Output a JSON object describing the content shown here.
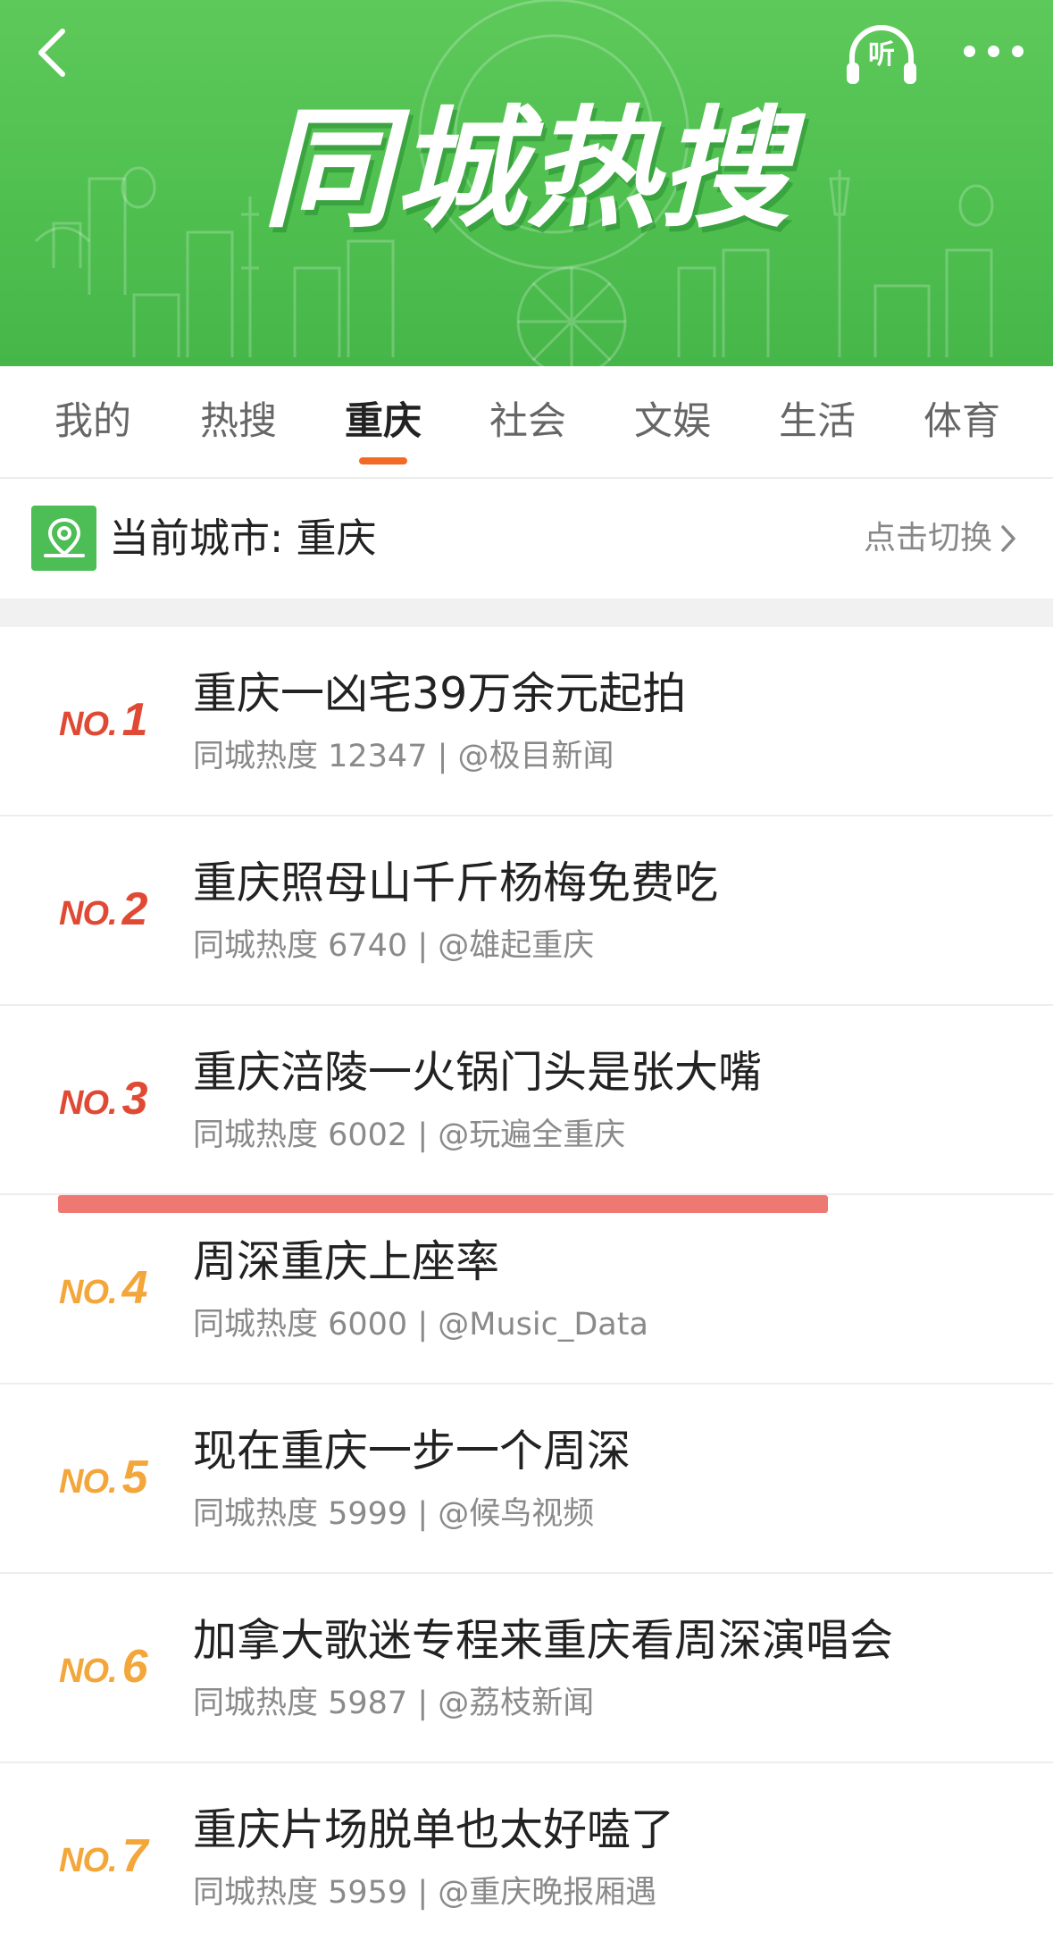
{
  "header": {
    "title": "同城热搜",
    "listen_label": "听",
    "back_icon": "chevron-left-icon",
    "more_icon": "more-dots-icon",
    "accent": "#4ebf4f"
  },
  "tabs": [
    {
      "label": "我的",
      "active": false
    },
    {
      "label": "热搜",
      "active": false
    },
    {
      "label": "重庆",
      "active": true
    },
    {
      "label": "社会",
      "active": false
    },
    {
      "label": "文娱",
      "active": false
    },
    {
      "label": "生活",
      "active": false
    },
    {
      "label": "体育",
      "active": false
    }
  ],
  "city": {
    "label": "当前城市: 重庆",
    "switch_label": "点击切换",
    "icon": "location-pin-icon"
  },
  "rank_prefix": "NO.",
  "items": [
    {
      "rank": "1",
      "title": "重庆一凶宅39万余元起拍",
      "meta": "同城热度 12347 | @极目新闻"
    },
    {
      "rank": "2",
      "title": "重庆照母山千斤杨梅免费吃",
      "meta": "同城热度 6740 | @雄起重庆"
    },
    {
      "rank": "3",
      "title": "重庆涪陵一火锅门头是张大嘴",
      "meta": "同城热度 6002 | @玩遍全重庆"
    },
    {
      "rank": "4",
      "title": "周深重庆上座率",
      "meta": "同城热度 6000 | @Music_Data"
    },
    {
      "rank": "5",
      "title": "现在重庆一步一个周深",
      "meta": "同城热度 5999 | @候鸟视频"
    },
    {
      "rank": "6",
      "title": "加拿大歌迷专程来重庆看周深演唱会",
      "meta": "同城热度 5987 | @荔枝新闻"
    },
    {
      "rank": "7",
      "title": "重庆片场脱单也太好嗑了",
      "meta": "同城热度 5959 | @重庆晚报厢遇"
    }
  ],
  "colors": {
    "rank_top": "#e04a35",
    "rank_low": "#f3a63a",
    "tab_indicator": "#f16a26",
    "annotation_mark": "#ee7872"
  }
}
